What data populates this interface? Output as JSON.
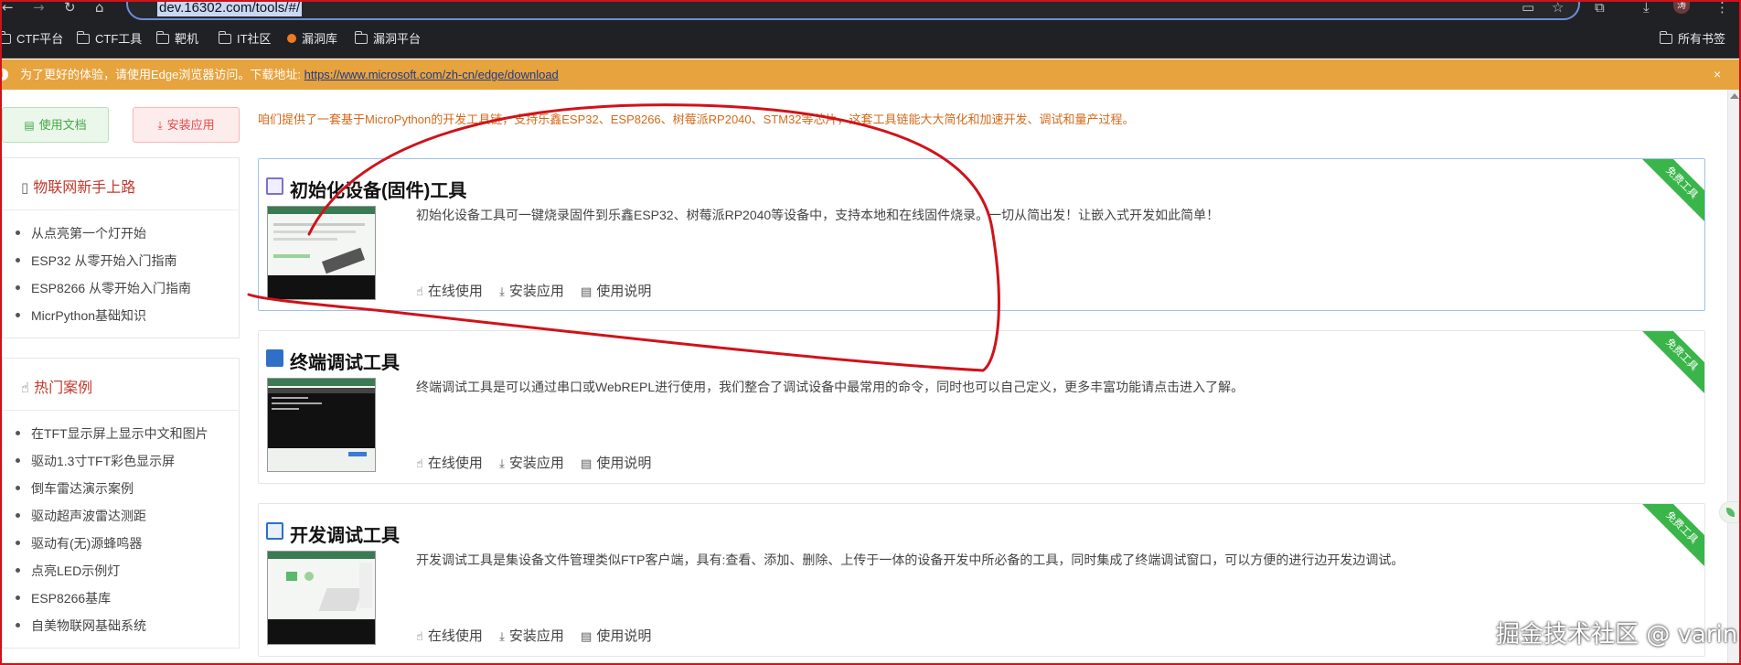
{
  "browser": {
    "url": "dev.16302.com/tools/#/",
    "avatar_text": "涛",
    "bookmarks": [
      "CTF平台",
      "CTF工具",
      "靶机",
      "IT社区",
      "漏洞库",
      "漏洞平台"
    ],
    "bookmarks_right": "所有书签"
  },
  "notice": {
    "message": "为了更好的体验，请使用Edge浏览器访问。下载地址:",
    "link": "https://www.microsoft.com/zh-cn/edge/download",
    "close": "×"
  },
  "sidebar": {
    "doc_button": "使用文档",
    "install_button": "安装应用",
    "beginner": {
      "title": "物联网新手上路",
      "items": [
        "从点亮第一个灯开始",
        "ESP32 从零开始入门指南",
        "ESP8266 从零开始入门指南",
        "MicrPython基础知识"
      ]
    },
    "hot": {
      "title": "热门案例",
      "items": [
        "在TFT显示屏上显示中文和图片",
        "驱动1.3寸TFT彩色显示屏",
        "倒车雷达演示案例",
        "驱动超声波雷达测距",
        "驱动有(无)源蜂鸣器",
        "点亮LED示例灯",
        "ESP8266基库",
        "自美物联网基础系统"
      ]
    }
  },
  "main": {
    "intro": "咱们提供了一套基于MicroPython的开发工具链，支持乐鑫ESP32、ESP8266、树莓派RP2040、STM32等芯片，这套工具链能大大简化和加速开发、调试和量产过程。",
    "actions": {
      "online": "在线使用",
      "install": "安装应用",
      "manual": "使用说明"
    },
    "ribbon": "免费工具",
    "cards": [
      {
        "title": "初始化设备(固件)工具",
        "desc": "初始化设备工具可一键烧录固件到乐鑫ESP32、树莓派RP2040等设备中，支持本地和在线固件烧录。一切从简出发！让嵌入式开发如此简单！"
      },
      {
        "title": "终端调试工具",
        "desc": "终端调试工具是可以通过串口或WebREPL进行使用，我们整合了调试设备中最常用的命令，同时也可以自己定义，更多丰富功能请点击进入了解。"
      },
      {
        "title": "开发调试工具",
        "desc": "开发调试工具是集设备文件管理类似FTP客户端，具有:查看、添加、删除、上传于一体的设备开发中所必备的工具，同时集成了终端调试窗口，可以方便的进行边开发边调试。"
      }
    ]
  },
  "watermark": "掘金技术社区 @ varin",
  "colors": {
    "accent_orange": "#e7a33e",
    "ribbon_green": "#3ab54a",
    "title_red": "#c0392b",
    "ink_red": "#d0121a"
  }
}
